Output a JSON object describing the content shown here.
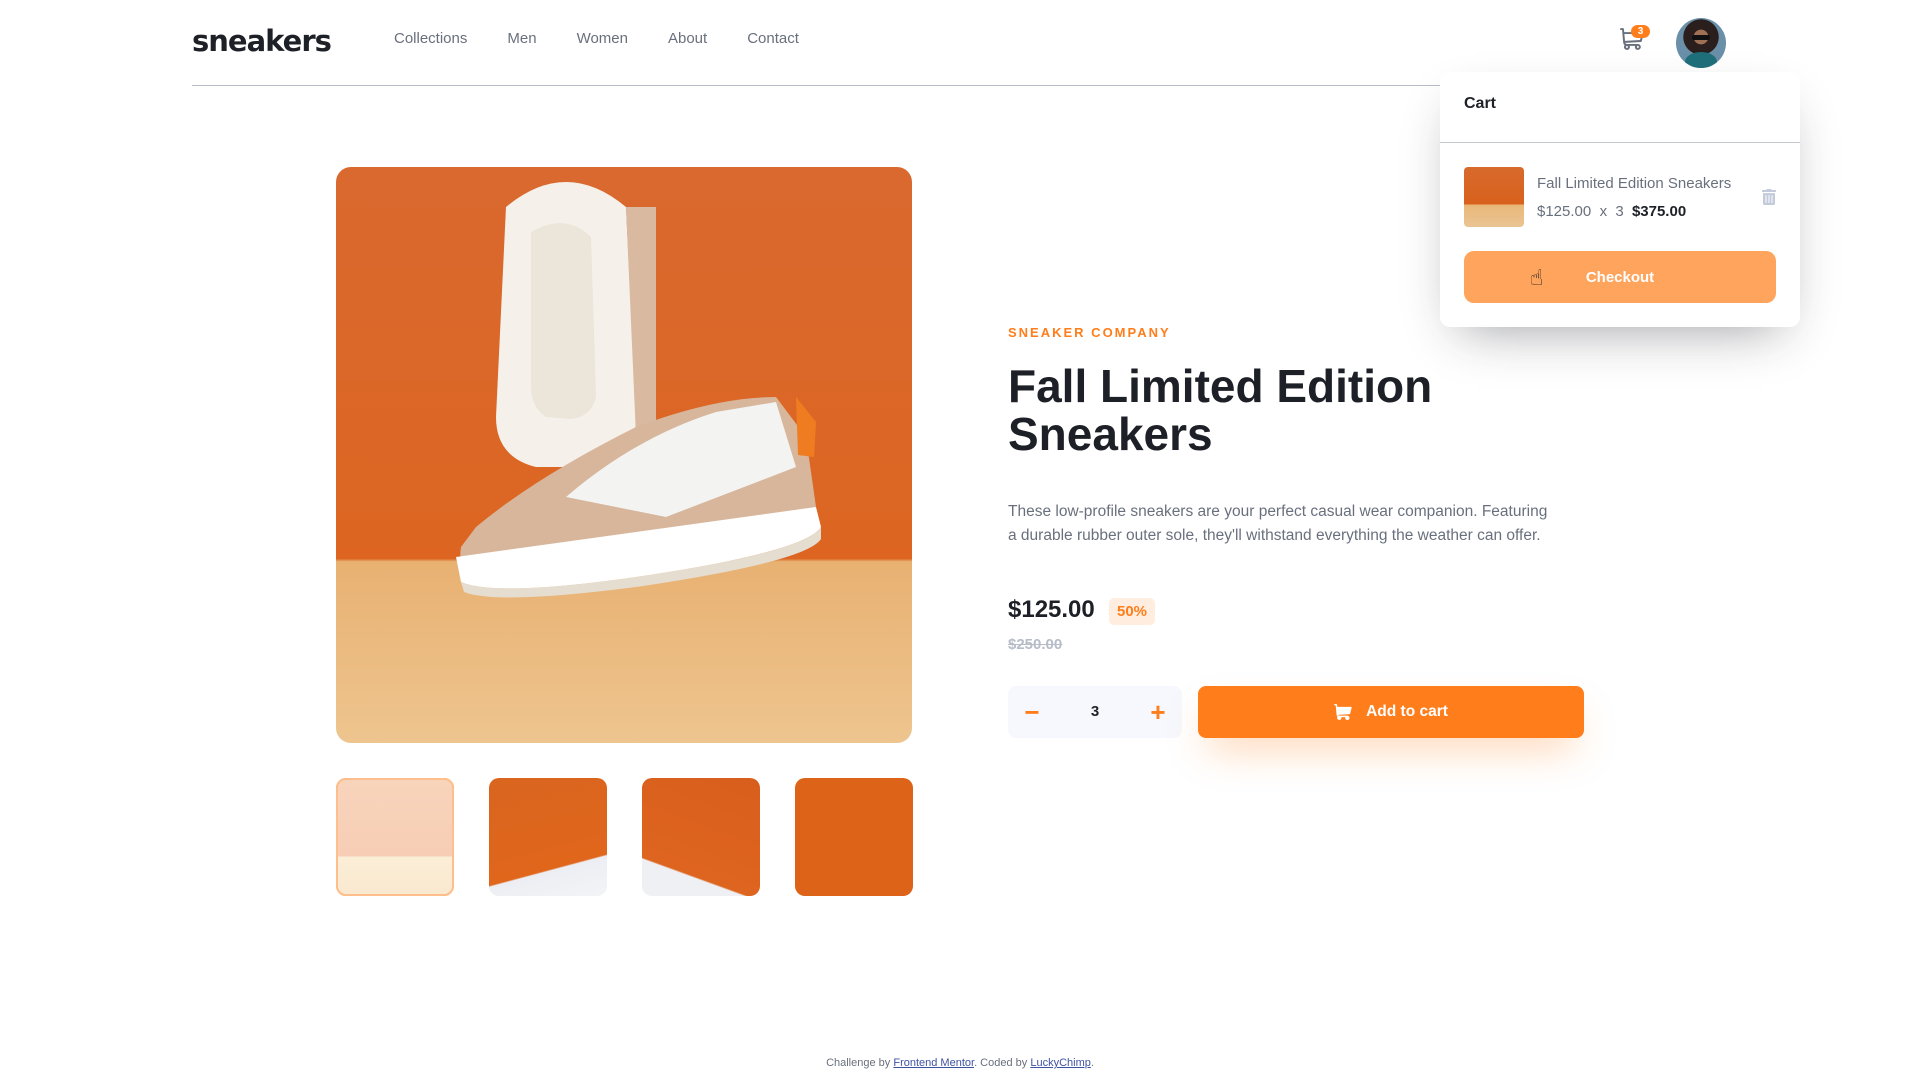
{
  "header": {
    "logo": "sneakers",
    "nav": [
      "Collections",
      "Men",
      "Women",
      "About",
      "Contact"
    ],
    "cart_count": "3",
    "avatar_alt": "user-avatar"
  },
  "cart": {
    "title": "Cart",
    "item": {
      "name": "Fall Limited Edition Sneakers",
      "unit_price": "$125.00",
      "times": "x",
      "quantity": "3",
      "total": "$375.00"
    },
    "checkout_label": "Checkout"
  },
  "gallery": {
    "thumbnails": [
      "product-1",
      "product-2",
      "product-3",
      "product-4"
    ],
    "active_index": 0
  },
  "product": {
    "company": "SNEAKER COMPANY",
    "title": "Fall Limited Edition Sneakers",
    "description": "These low-profile sneakers are your perfect casual wear companion. Featuring a durable rubber outer sole, they'll withstand everything the weather can offer.",
    "price": "$125.00",
    "discount": "50%",
    "original_price": "$250.00",
    "quantity": "3",
    "minus_label": "−",
    "plus_label": "+",
    "add_to_cart_label": "Add to cart"
  },
  "footer": {
    "prefix": "Challenge by ",
    "link1": "Frontend Mentor",
    "middle": ". Coded by ",
    "link2": "LuckyChimp",
    "suffix": "."
  },
  "colors": {
    "accent": "#ff7e1b",
    "accent_light": "#ffede0",
    "checkout_hover": "#ffa45c",
    "text_dark": "#1d2026",
    "text_muted": "#69707d"
  }
}
